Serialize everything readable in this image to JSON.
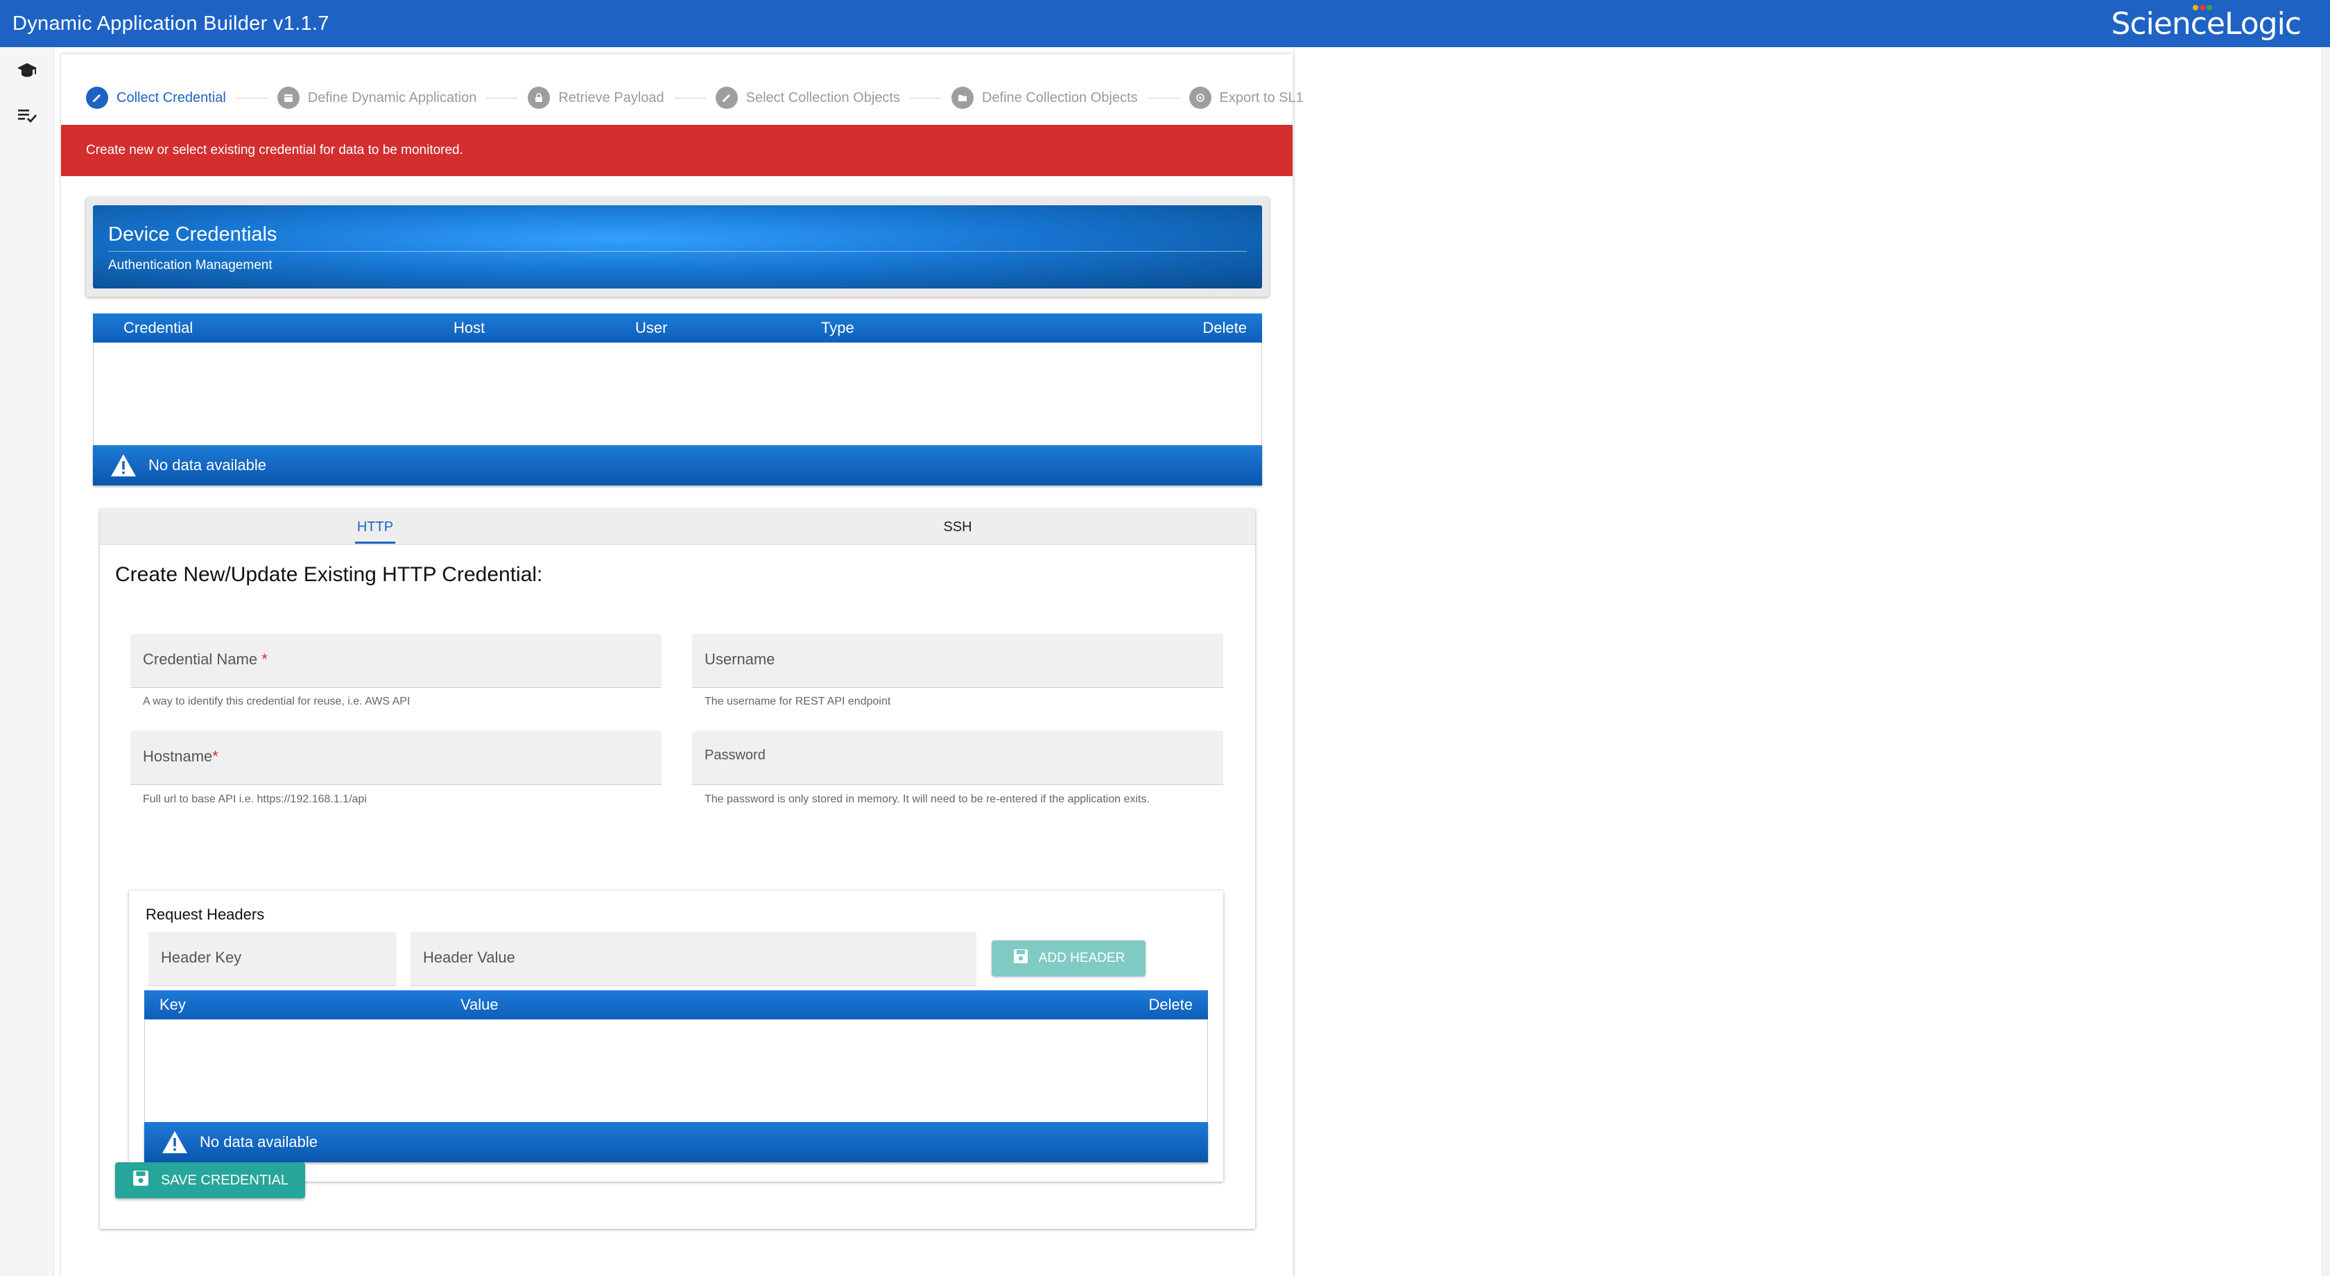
{
  "app": {
    "title": "Dynamic Application Builder v1.1.7",
    "brand": "ScienceLogic"
  },
  "sidebar": {
    "icons": [
      "graduation-cap-icon",
      "checklist-icon"
    ]
  },
  "stepper": {
    "steps": [
      {
        "label": "Collect Credential",
        "icon": "pencil-icon",
        "active": true
      },
      {
        "label": "Define Dynamic Application",
        "icon": "calendar-icon",
        "active": false
      },
      {
        "label": "Retrieve Payload",
        "icon": "lock-icon",
        "active": false
      },
      {
        "label": "Select Collection Objects",
        "icon": "pencil-icon",
        "active": false
      },
      {
        "label": "Define Collection Objects",
        "icon": "folder-icon",
        "active": false
      },
      {
        "label": "Export to SL1",
        "icon": "export-icon",
        "active": false
      }
    ]
  },
  "alert": {
    "text": "Create new or select existing credential for data to be monitored.",
    "color": "#d32f2f"
  },
  "device_credentials": {
    "title": "Device Credentials",
    "subtitle": "Authentication Management",
    "columns": [
      "Credential",
      "Host",
      "User",
      "Type",
      "Delete"
    ],
    "rows": [],
    "empty_text": "No data available"
  },
  "tabs": {
    "http": "HTTP",
    "ssh": "SSH",
    "selected": "HTTP"
  },
  "form": {
    "title": "Create New/Update Existing HTTP Credential:",
    "credential_name": {
      "label": "Credential Name",
      "required": "*",
      "hint": "A way to identify this credential for reuse, i.e. AWS API",
      "value": ""
    },
    "username": {
      "label": "Username",
      "hint": "The username for REST API endpoint",
      "value": ""
    },
    "hostname": {
      "label": "Hostname",
      "required": "*",
      "hint": "Full url to base API i.e. https://192.168.1.1/api",
      "value": ""
    },
    "password": {
      "label": "Password",
      "hint": "The password is only stored in memory. It will need to be re-entered if the application exits.",
      "value": ""
    }
  },
  "request_headers": {
    "title": "Request Headers",
    "key_placeholder": "Header Key",
    "value_placeholder": "Header Value",
    "add_button": "ADD HEADER",
    "columns": [
      "Key",
      "Value",
      "Delete"
    ],
    "rows": [],
    "empty_text": "No data available"
  },
  "save_button": "SAVE CREDENTIAL",
  "colors": {
    "primary": "#1e63c4",
    "accent": "#26a69a",
    "accent_disabled": "#80cbc4",
    "error": "#d32f2f"
  }
}
